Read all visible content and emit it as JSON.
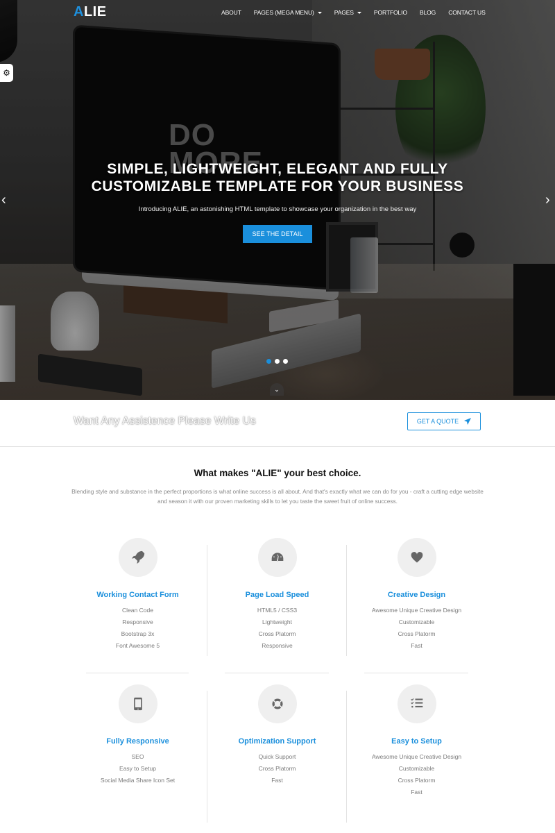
{
  "brand": {
    "logo_accent": "A",
    "logo_rest": "LIE",
    "accent_color": "#1a8fdc"
  },
  "nav": {
    "items": [
      {
        "label": "ABOUT",
        "dropdown": false
      },
      {
        "label": "PAGES (MEGA MENU)",
        "dropdown": true
      },
      {
        "label": "PAGES",
        "dropdown": true
      },
      {
        "label": "PORTFOLIO",
        "dropdown": false
      },
      {
        "label": "BLOG",
        "dropdown": false
      },
      {
        "label": "CONTACT US",
        "dropdown": false
      }
    ]
  },
  "settings_toggle": {
    "icon": "gear-icon",
    "glyph": "⚙"
  },
  "hero": {
    "title_line1": "SIMPLE, LIGHTWEIGHT, ELEGANT AND FULLY",
    "title_line2": "CUSTOMIZABLE TEMPLATE FOR YOUR BUSINESS",
    "subtitle": "Introducing ALIE, an astonishing HTML template to showcase your organization in the best way",
    "cta_label": "SEE THE DETAIL",
    "prev_glyph": "‹",
    "next_glyph": "›",
    "image_text": "DO MORE",
    "slides": {
      "count": 3,
      "active": 1
    },
    "scroll_down_glyph": "⌄"
  },
  "assist": {
    "text": "Want Any Assistence Please Write Us",
    "button_label": "GET A QUOTE",
    "button_icon": "paper-plane-icon"
  },
  "features_section": {
    "title": "What makes \"ALIE\" your best choice.",
    "description": "Blending style and substance in the perfect proportions is what online success is all about. And that's exactly what we can do for you - craft a cutting edge website and season it with our proven marketing skills to let you taste the sweet fruit of online success.",
    "features": [
      {
        "icon": "rocket-icon",
        "title": "Working Contact Form",
        "items": [
          "Clean Code",
          "Responsive",
          "Bootstrap 3x",
          "Font Awesome 5"
        ]
      },
      {
        "icon": "speedometer-icon",
        "title": "Page Load Speed",
        "items": [
          "HTML5 / CSS3",
          "Lightweight",
          "Cross Platorm",
          "Responsive"
        ]
      },
      {
        "icon": "heart-icon",
        "title": "Creative Design",
        "items": [
          "Awesome Unique Creative Design",
          "Customizable",
          "Cross Platorm",
          "Fast"
        ]
      },
      {
        "icon": "mobile-icon",
        "title": "Fully Responsive",
        "items": [
          "SEO",
          "Easy to Setup",
          "Social Media Share Icon Set"
        ]
      },
      {
        "icon": "life-ring-icon",
        "title": "Optimization Support",
        "items": [
          "Quick Support",
          "Cross Platorm",
          "Fast"
        ]
      },
      {
        "icon": "checklist-icon",
        "title": "Easy to Setup",
        "items": [
          "Awesome Unique Creative Design",
          "Customizable",
          "Cross Platorm",
          "Fast"
        ]
      }
    ]
  }
}
